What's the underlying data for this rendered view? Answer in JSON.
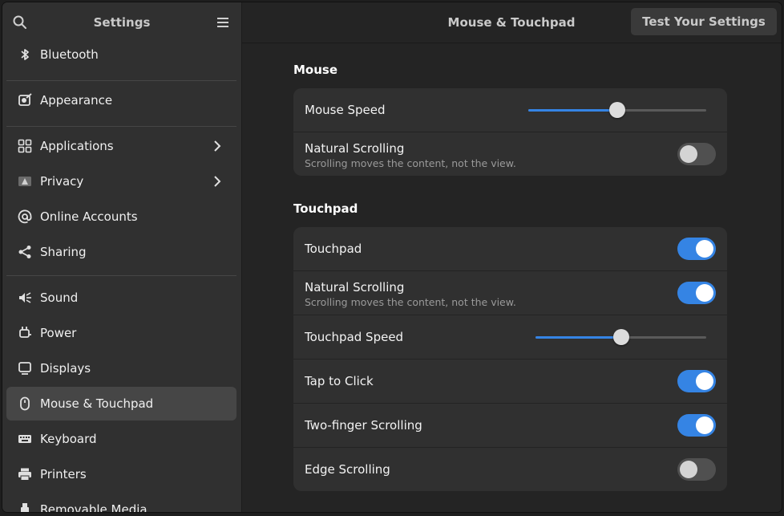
{
  "sidebar": {
    "title": "Settings",
    "items": [
      {
        "label": "Bluetooth",
        "icon": "bluetooth-icon"
      },
      {
        "label": "Appearance",
        "icon": "appearance-icon"
      },
      {
        "label": "Applications",
        "icon": "applications-icon",
        "has_submenu": true
      },
      {
        "label": "Privacy",
        "icon": "privacy-icon",
        "has_submenu": true
      },
      {
        "label": "Online Accounts",
        "icon": "at-sign-icon"
      },
      {
        "label": "Sharing",
        "icon": "share-icon"
      },
      {
        "label": "Sound",
        "icon": "speaker-icon"
      },
      {
        "label": "Power",
        "icon": "power-plug-icon"
      },
      {
        "label": "Displays",
        "icon": "display-icon"
      },
      {
        "label": "Mouse & Touchpad",
        "icon": "mouse-icon",
        "active": true
      },
      {
        "label": "Keyboard",
        "icon": "keyboard-icon"
      },
      {
        "label": "Printers",
        "icon": "printer-icon"
      },
      {
        "label": "Removable Media",
        "icon": "usb-icon"
      }
    ]
  },
  "header": {
    "title": "Mouse & Touchpad",
    "test_button": "Test Your Settings"
  },
  "mouse": {
    "section_title": "Mouse",
    "speed": {
      "label": "Mouse Speed",
      "value": 0.5
    },
    "natural_scrolling": {
      "label": "Natural Scrolling",
      "subtitle": "Scrolling moves the content, not the view.",
      "enabled": false
    }
  },
  "touchpad": {
    "section_title": "Touchpad",
    "touchpad": {
      "label": "Touchpad",
      "enabled": true
    },
    "natural_scrolling": {
      "label": "Natural Scrolling",
      "subtitle": "Scrolling moves the content, not the view.",
      "enabled": true
    },
    "speed": {
      "label": "Touchpad Speed",
      "value": 0.5
    },
    "tap_to_click": {
      "label": "Tap to Click",
      "enabled": true
    },
    "two_finger_scrolling": {
      "label": "Two-finger Scrolling",
      "enabled": true
    },
    "edge_scrolling": {
      "label": "Edge Scrolling",
      "enabled": false
    }
  },
  "colors": {
    "accent": "#3584e4",
    "sidebar_bg": "#303030",
    "main_bg": "#242424",
    "row_bg": "#303030"
  }
}
